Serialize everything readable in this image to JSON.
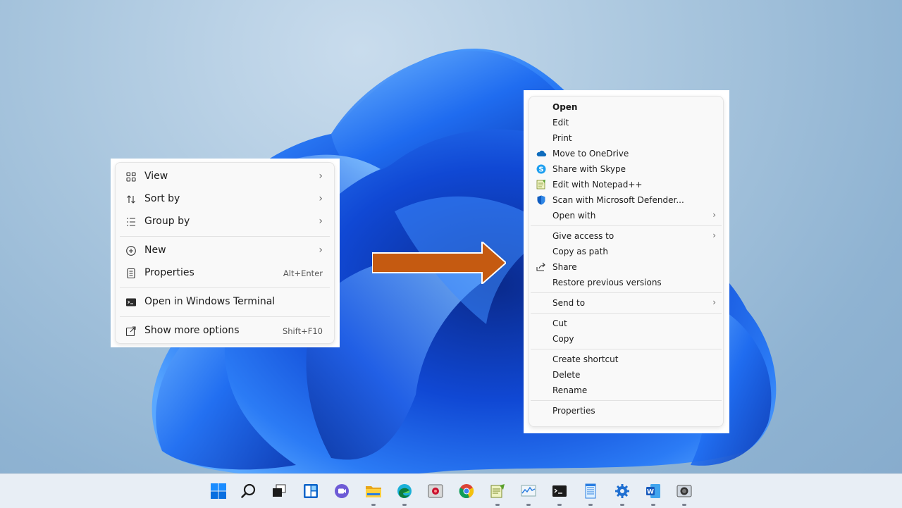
{
  "left_menu": {
    "items": [
      {
        "label": "View",
        "icon": "view-grid-icon",
        "submenu": true
      },
      {
        "label": "Sort by",
        "icon": "sort-icon",
        "submenu": true
      },
      {
        "label": "Group by",
        "icon": "group-list-icon",
        "submenu": true
      },
      {
        "label": "New",
        "icon": "new-plus-icon",
        "submenu": true
      },
      {
        "label": "Properties",
        "icon": "properties-icon",
        "shortcut": "Alt+Enter"
      },
      {
        "label": "Open in Windows Terminal",
        "icon": "terminal-icon"
      },
      {
        "label": "Show more options",
        "icon": "more-options-icon",
        "shortcut": "Shift+F10"
      }
    ]
  },
  "right_menu": {
    "items": [
      {
        "label": "Open"
      },
      {
        "label": "Edit"
      },
      {
        "label": "Print"
      },
      {
        "label": "Move to OneDrive",
        "icon": "onedrive-icon"
      },
      {
        "label": "Share with Skype",
        "icon": "skype-icon"
      },
      {
        "label": "Edit with Notepad++",
        "icon": "notepad-plus-plus-icon"
      },
      {
        "label": "Scan with Microsoft Defender...",
        "icon": "defender-shield-icon"
      },
      {
        "label": "Open with"
      },
      {
        "label": "Give access to"
      },
      {
        "label": "Copy as path"
      },
      {
        "label": "Share",
        "icon": "share-icon"
      },
      {
        "label": "Restore previous versions"
      },
      {
        "label": "Send to"
      },
      {
        "label": "Cut"
      },
      {
        "label": "Copy"
      },
      {
        "label": "Create shortcut"
      },
      {
        "label": "Delete"
      },
      {
        "label": "Rename"
      },
      {
        "label": "Properties"
      }
    ]
  },
  "arrow_color": "#c55a11",
  "taskbar": {
    "icons": [
      "start-icon",
      "search-icon",
      "task-view-icon",
      "widgets-icon",
      "teams-chat-icon",
      "file-explorer-icon",
      "edge-icon",
      "app-icon",
      "chrome-icon",
      "notepad-plus-plus-icon",
      "resource-monitor-icon",
      "terminal-icon",
      "notepad-icon",
      "settings-gear-icon",
      "word-icon",
      "camera-app-icon"
    ]
  }
}
